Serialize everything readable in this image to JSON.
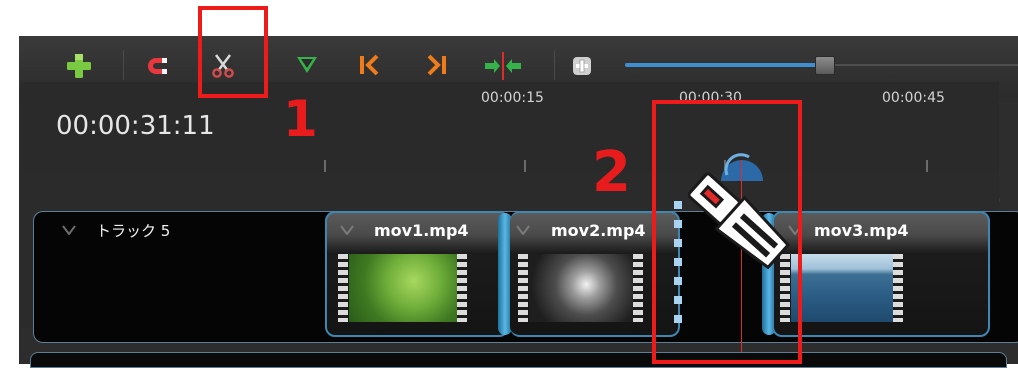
{
  "toolbar": {
    "buttons": [
      {
        "name": "add-track",
        "icon": "plus-icon",
        "color": "#7ac943"
      },
      {
        "name": "snap",
        "icon": "magnet-icon",
        "color": "#e8383d"
      },
      {
        "name": "razor",
        "icon": "scissors-icon",
        "color": "#d64b4b"
      },
      {
        "name": "add-marker",
        "icon": "triangle-down-icon",
        "color": "#35b34a"
      },
      {
        "name": "previous-marker",
        "icon": "jump-start-icon",
        "color": "#f07b1a"
      },
      {
        "name": "next-marker",
        "icon": "jump-end-icon",
        "color": "#f07b1a"
      },
      {
        "name": "center-playhead",
        "icon": "center-arrows-icon",
        "color": "#35b34a"
      },
      {
        "name": "zoom",
        "icon": "zoom-icon",
        "color": "#cfcfcf"
      }
    ],
    "zoom_level": 0.5
  },
  "timeline": {
    "current_time": "00:00:31:11",
    "tick_labels": [
      "00:00:15",
      "00:00:30",
      "00:00:45"
    ]
  },
  "track": {
    "name": "トラック 5",
    "clips": [
      {
        "title": "mov1.mp4",
        "thumbnail": "green-foliage"
      },
      {
        "title": "mov2.mp4",
        "thumbnail": "waterfall"
      },
      {
        "title": "mov3.mp4",
        "thumbnail": "ocean"
      }
    ]
  },
  "annotations": {
    "label_1": "1",
    "label_2": "2",
    "color": "#ee1b1b"
  }
}
